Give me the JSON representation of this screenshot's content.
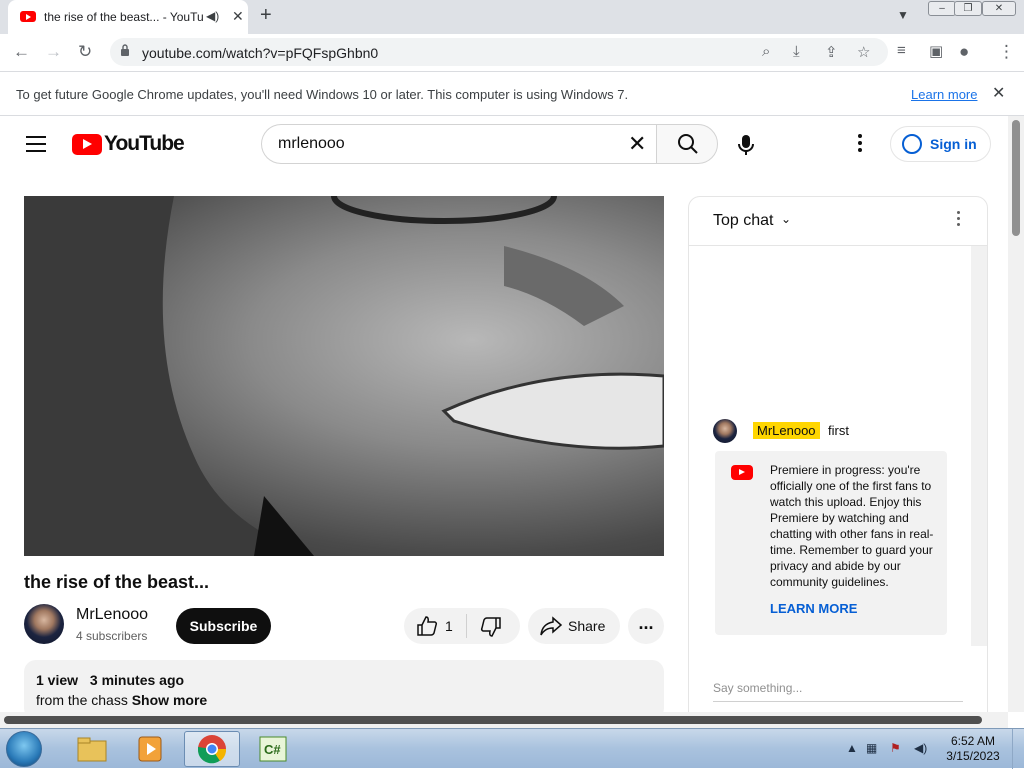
{
  "browser": {
    "tab_title": "the rise of the beast... - YouTube",
    "url": "youtube.com/watch?v=pFQFspGhbn0",
    "infobar_message": "To get future Google Chrome updates, you'll need Windows 10 or later. This computer is using Windows 7.",
    "infobar_link": "Learn more"
  },
  "youtube": {
    "logo_text": "YouTube",
    "search_query": "mrlenooo",
    "sign_in_label": "Sign in",
    "video_title": "the rise of the beast...",
    "channel_name": "MrLenooo",
    "subscribers": "4 subscribers",
    "subscribe_label": "Subscribe",
    "like_count": "1",
    "share_label": "Share",
    "more_label": "...",
    "views": "1 view",
    "posted": "3 minutes ago",
    "description": "from the chass",
    "show_more": "Show more"
  },
  "chat": {
    "mode_label": "Top chat",
    "message_author": "MrLenooo",
    "message_text": "first",
    "premiere_text": "Premiere in progress: you're officially one of the first fans to watch this upload. Enjoy this Premiere by watching and chatting with other fans in real-time. Remember to guard your privacy and abide by our community guidelines.",
    "learn_more": "LEARN MORE",
    "input_placeholder": "Say something..."
  },
  "taskbar": {
    "time": "6:52 AM",
    "date": "3/15/2023"
  },
  "colors": {
    "youtube_red": "#ff0000",
    "link_blue": "#065fd4",
    "author_highlight": "#ffd600"
  }
}
